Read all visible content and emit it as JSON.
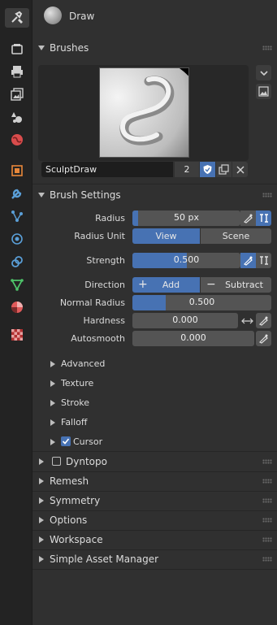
{
  "header": {
    "title": "Draw"
  },
  "tabs": [
    "tool-tab",
    "render-tab",
    "output-tab",
    "view-layer-tab",
    "scene-tab",
    "world-tab",
    "object-tab",
    "modifier-tab",
    "particles-tab",
    "physics-tab",
    "constraints-tab",
    "data-tab",
    "material-tab",
    "texture-tab"
  ],
  "brushes": {
    "label": "Brushes",
    "brush_name": "SculptDraw",
    "users": "2"
  },
  "brush_settings": {
    "label": "Brush Settings",
    "radius": {
      "label": "Radius",
      "value": "50 px",
      "fill": 0.05
    },
    "radius_unit": {
      "label": "Radius Unit",
      "options": [
        "View",
        "Scene"
      ],
      "selected": "View"
    },
    "strength": {
      "label": "Strength",
      "value": "0.500",
      "fill": 0.5
    },
    "direction": {
      "label": "Direction",
      "add": "Add",
      "subtract": "Subtract",
      "selected": "Add"
    },
    "normal_radius": {
      "label": "Normal Radius",
      "value": "0.500",
      "fill": 0.24
    },
    "hardness": {
      "label": "Hardness",
      "value": "0.000"
    },
    "autosmooth": {
      "label": "Autosmooth",
      "value": "0.000"
    },
    "subpanels": [
      "Advanced",
      "Texture",
      "Stroke",
      "Falloff"
    ],
    "cursor": {
      "label": "Cursor",
      "checked": true
    }
  },
  "panels": {
    "dyntopo": {
      "label": "Dyntopo",
      "checked": false
    },
    "others": [
      "Remesh",
      "Symmetry",
      "Options",
      "Workspace",
      "Simple Asset Manager"
    ]
  },
  "colors": {
    "accent": "#4772b3",
    "panel": "#303030",
    "tabbar": "#232323",
    "field": "#545454"
  }
}
